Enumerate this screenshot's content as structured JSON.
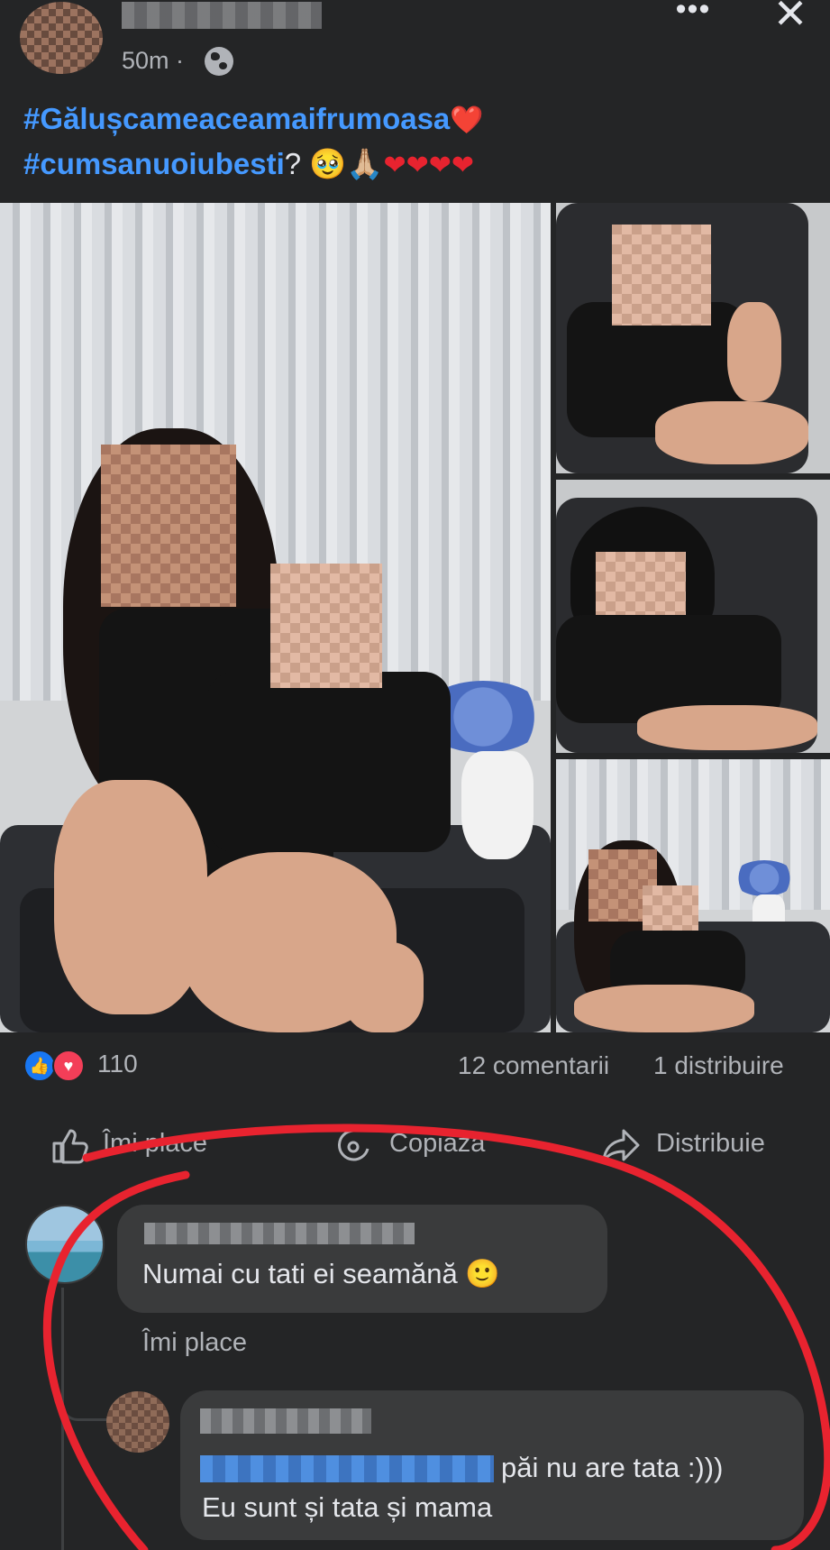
{
  "post": {
    "timestamp": "50m ·",
    "privacy_icon": "globe-icon",
    "more_icon": "more-horizontal-icon",
    "close_icon": "close-icon",
    "caption": {
      "hashtag1": "#Gălușcameaceamaifrumoasa",
      "hashtag2": "#cumsanuoiubesti",
      "after_hashtag2": "?",
      "emoji_line1": "❤️",
      "emoji_line2": "🥹🙏🏼",
      "hearts": "❤❤❤❤"
    }
  },
  "stats": {
    "reaction_count": "110",
    "comments": "12 comentarii",
    "shares": "1 distribuire",
    "like_emoji": "👍",
    "love_emoji": "♥"
  },
  "actions": {
    "like": "Îmi place",
    "copy": "Copiază",
    "share": "Distribuie"
  },
  "comments": [
    {
      "text": "Numai cu tati ei seamănă 🙂",
      "like_label": "Îmi place"
    }
  ],
  "reply": {
    "line1": "păi nu are tata :)))",
    "line2": "Eu sunt și tata și mama"
  },
  "colors": {
    "background": "#242526",
    "bubble": "#3a3b3c",
    "hashtag": "#4599ff",
    "annotation_red": "#e8232f"
  }
}
